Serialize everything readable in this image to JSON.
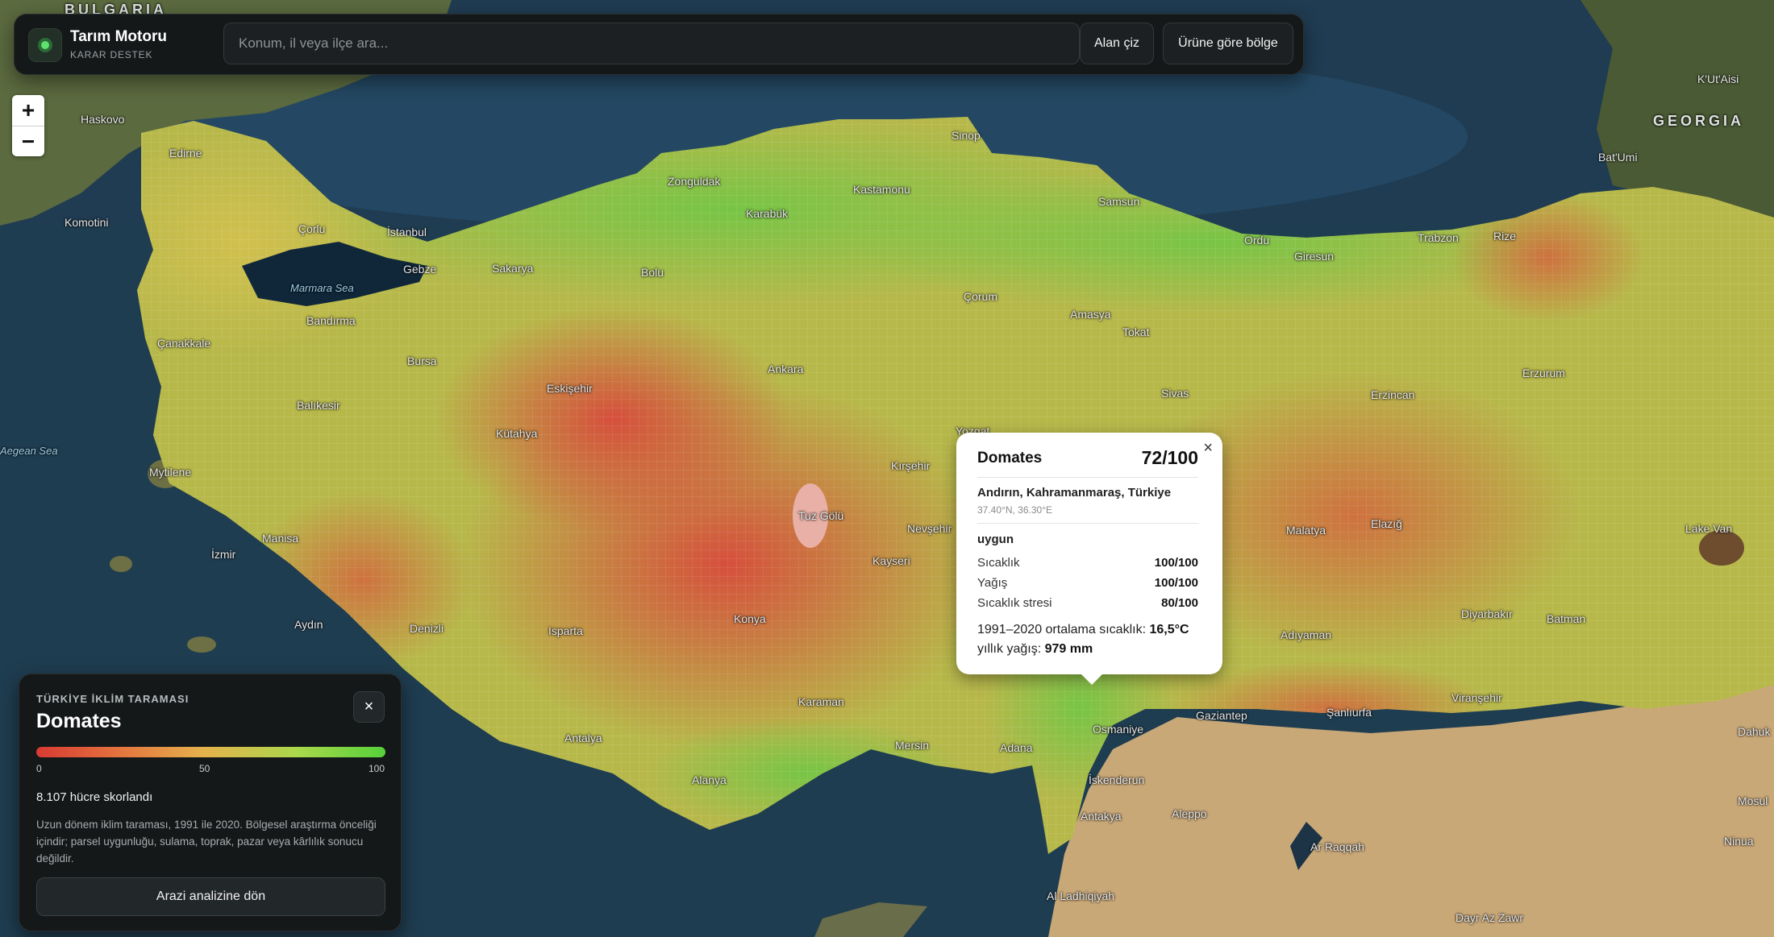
{
  "app": {
    "brand_title": "Tarım Motoru",
    "brand_subtitle": "KARAR DESTEK",
    "search_placeholder": "Konum, il veya ilçe ara...",
    "draw_area_label": "Alan çiz",
    "region_by_crop_label": "Ürüne göre bölge"
  },
  "zoom": {
    "in_label": "+",
    "out_label": "−"
  },
  "popup": {
    "close_label": "×",
    "crop": "Domates",
    "score": "72/100",
    "location": "Andırın, Kahramanmaraş, Türkiye",
    "coordinates": "37.40°N, 36.30°E",
    "status": "uygun",
    "metrics": [
      {
        "label": "Sıcaklık",
        "value": "100/100"
      },
      {
        "label": "Yağış",
        "value": "100/100"
      },
      {
        "label": "Sıcaklık stresi",
        "value": "80/100"
      }
    ],
    "climate_prefix": "1991–2020 ortalama sıcaklık:",
    "climate_value": "16,5°C",
    "rain_prefix": "yıllık yağış:",
    "rain_value": "979 mm"
  },
  "panel": {
    "eyebrow": "TÜRKİYE İKLİM TARAMASI",
    "title": "Domates",
    "close_label": "×",
    "scale_min": "0",
    "scale_mid": "50",
    "scale_max": "100",
    "cells_scored": "8.107 hücre skorlandı",
    "description": "Uzun dönem iklim taraması, 1991 ile 2020. Bölgesel araştırma önceliği içindir; parsel uygunluğu, sulama, toprak, pazar veya kârlılık sonucu değildir.",
    "back_button": "Arazi analizine dön",
    "gradient_colors": [
      "#d83a33",
      "#e36a3c",
      "#e6b24c",
      "#a9d84b",
      "#56d03a"
    ]
  },
  "map_labels": [
    "BULGARIA",
    "GEORGIA",
    "Haskovo",
    "Edirne",
    "Komotini",
    "Çorlu",
    "İstanbul",
    "Gebze",
    "Marmara Sea",
    "Bandırma",
    "Çanakkale",
    "Bursa",
    "Balıkesir",
    "Mytilene",
    "Aegean Sea",
    "İzmir",
    "Manisa",
    "Aydın",
    "Denizli",
    "Isparta",
    "Antalya",
    "Alanya",
    "Konya",
    "Karaman",
    "Mersin",
    "Adana",
    "Kayseri",
    "Nevşehir",
    "Kırşehir",
    "Ankara",
    "Eskişehir",
    "Kütahya",
    "Zonguldak",
    "Karabük",
    "Kastamonu",
    "Samsun",
    "Ordu",
    "Giresun",
    "Trabzon",
    "Rize",
    "Bat'Umi",
    "K'Ut'Aisi",
    "Tokat",
    "Sivas",
    "Erzincan",
    "Erzurum",
    "Malatya",
    "Elazığ",
    "Diyarbakır",
    "Batman",
    "Adıyaman",
    "Gaziantep",
    "Şanlıurfa",
    "Viranşehir",
    "İskenderun",
    "Osmaniye",
    "Antakya",
    "Aleppo",
    "Ar Raqqah",
    "Al Ladhiqiyah",
    "Dayr Az Zawr",
    "Mosul",
    "Ninua",
    "Dahuk",
    "Lake Van",
    "Tuz Gölü",
    "Sakarya",
    "Bolu",
    "Çorum",
    "Amasya",
    "Yozgat",
    "Sinop"
  ]
}
